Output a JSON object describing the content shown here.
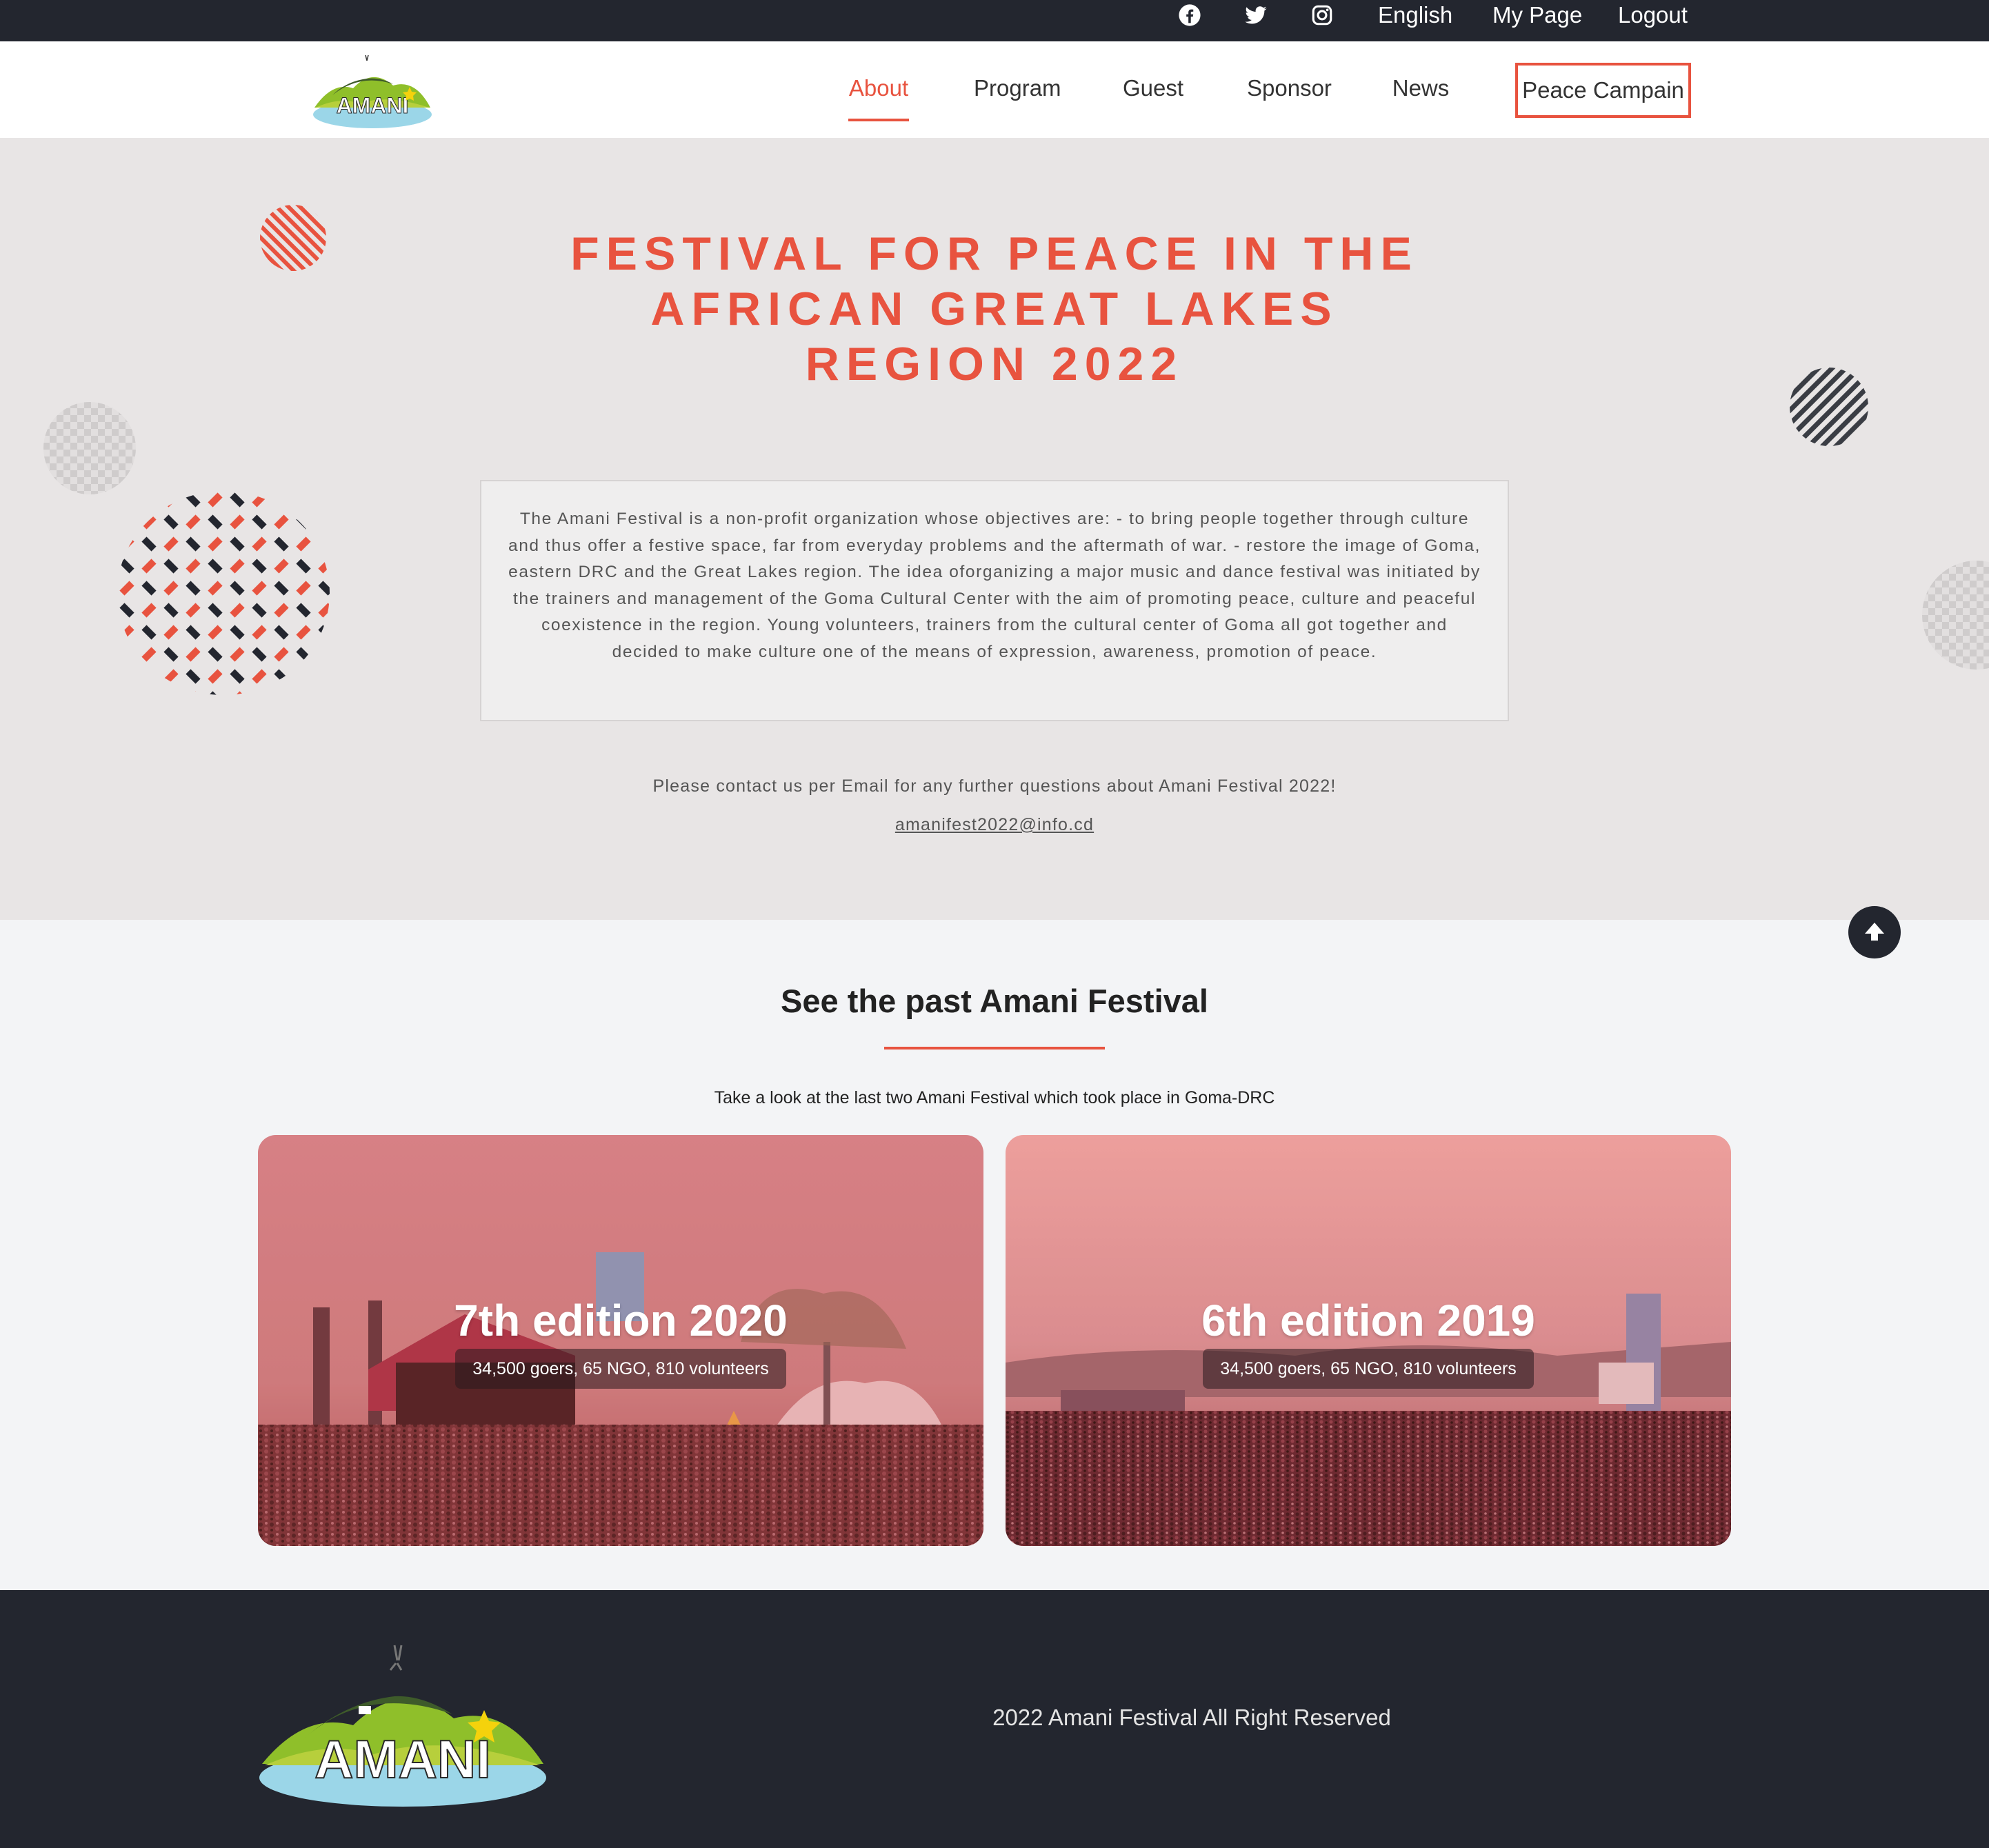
{
  "topbar": {
    "social": [
      "facebook-icon",
      "twitter-icon",
      "instagram-icon"
    ],
    "language": "English",
    "my_page": "My Page",
    "logout": "Logout"
  },
  "nav": {
    "logo_text": "AMANI",
    "items": [
      {
        "label": "About",
        "active": true
      },
      {
        "label": "Program"
      },
      {
        "label": "Guest"
      },
      {
        "label": "Sponsor"
      },
      {
        "label": "News"
      }
    ],
    "cta": "Peace Campain"
  },
  "hero": {
    "title_lines": [
      "FESTIVAL FOR PEACE IN THE",
      "AFRICAN GREAT LAKES",
      "REGION 2022"
    ],
    "description": "The Amani Festival is a non-profit organization whose objectives are: - to bring people together through culture and thus offer a festive space, far from everyday problems and the aftermath of war. - restore the image of Goma, eastern DRC and the Great Lakes region. The idea oforganizing a major music and dance festival was initiated by the trainers and management of the Goma Cultural Center with the aim of promoting peace, culture and peaceful coexistence in the region. Young volunteers, trainers from the cultural center of Goma all got together and decided to make culture one of the means of expression, awareness, promotion of peace.",
    "contact_text": "Please contact us per Email for any further questions about Amani Festival 2022!",
    "email": "amanifest2022@info.cd"
  },
  "past": {
    "title": "See the past Amani Festival",
    "subtitle": "Take a look at the last two Amani Festival which took place in Goma-DRC",
    "cards": [
      {
        "title": "7th edition 2020",
        "stats": "34,500 goers, 65 NGO, 810 volunteers"
      },
      {
        "title": "6th edition 2019",
        "stats": "34,500 goers, 65 NGO, 810 volunteers"
      }
    ]
  },
  "footer": {
    "logo_text": "AMANI",
    "copyright": "2022 Amani Festival All Right Reserved"
  },
  "colors": {
    "accent": "#e8533f",
    "dark": "#23262f",
    "hero_bg": "#e8e5e5",
    "section_bg": "#f3f4f6"
  }
}
